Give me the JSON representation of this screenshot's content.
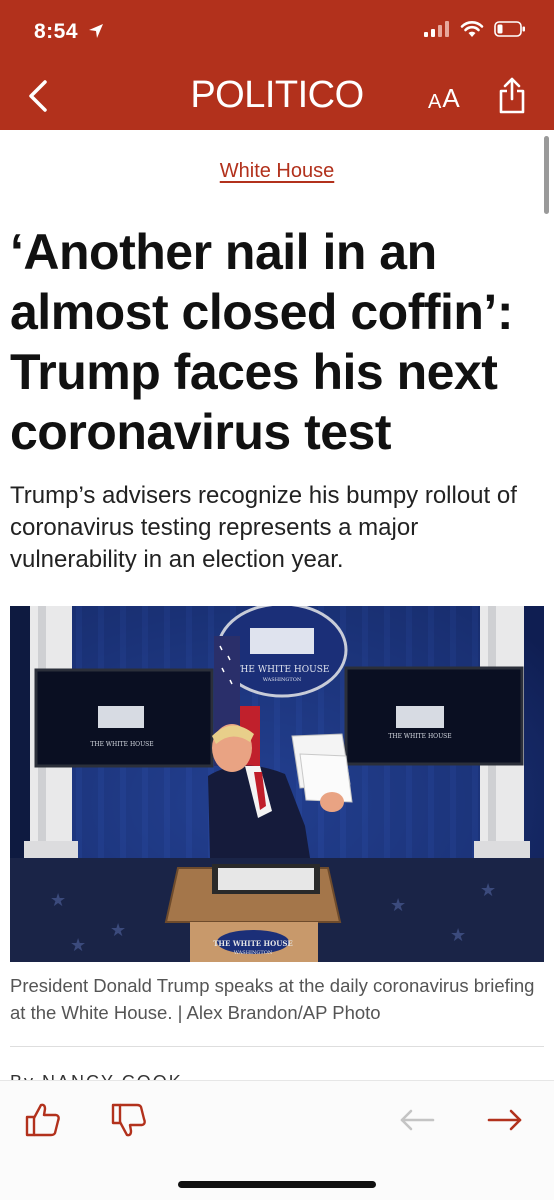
{
  "status_bar": {
    "time": "8:54",
    "icons": [
      "location-arrow-icon",
      "cellular-signal-icon",
      "wifi-icon",
      "battery-icon"
    ]
  },
  "nav": {
    "brand": "POLITICO",
    "text_size_label_small": "A",
    "text_size_label_large": "A",
    "icons": [
      "chevron-left-icon",
      "share-icon"
    ]
  },
  "article": {
    "section": "White House",
    "headline": "‘Another nail in an almost closed coffin’: Trump faces his next coronavirus test",
    "dek": "Trump’s advisers recognize his bumpy rollout of coronavirus testing represents a major vulnerability in an election year.",
    "photo": {
      "seal_text": "THE WHITE HOUSE",
      "seal_subtext": "WASHINGTON",
      "screen_left_label": "THE WHITE HOUSE",
      "screen_right_label": "THE WHITE HOUSE",
      "podium_text": "THE WHITE HOUSE",
      "podium_subtext": "WASHINGTON"
    },
    "caption": "President Donald Trump speaks at the daily coronavirus briefing at the White House. | Alex Brandon/AP Photo",
    "byline": "By NANCY COOK"
  },
  "toolbar": {
    "icons": [
      "thumbs-up-icon",
      "thumbs-down-icon",
      "arrow-left-icon",
      "arrow-right-icon"
    ]
  },
  "colors": {
    "brand_red": "#b2311c",
    "link_red": "#b2311c",
    "disabled_gray": "#c4c4c4"
  }
}
